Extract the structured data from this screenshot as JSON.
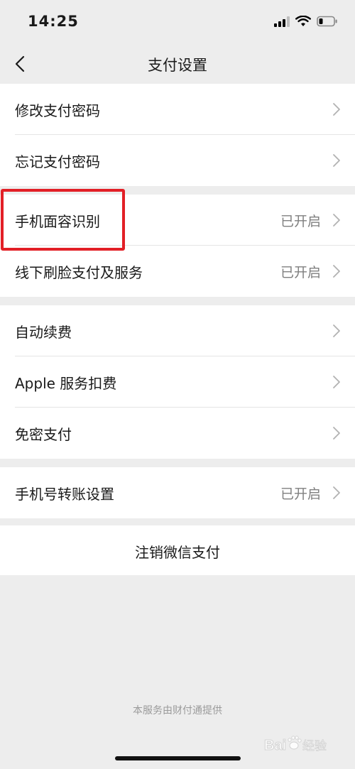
{
  "status_bar": {
    "time": "14:25",
    "icons": [
      "signal-icon",
      "wifi-icon",
      "battery-icon"
    ]
  },
  "nav": {
    "title": "支付设置",
    "back_icon": "chevron-left-icon"
  },
  "groups": [
    {
      "items": [
        {
          "label": "修改支付密码",
          "value": ""
        },
        {
          "label": "忘记支付密码",
          "value": ""
        }
      ]
    },
    {
      "items": [
        {
          "label": "手机面容识别",
          "value": "已开启"
        },
        {
          "label": "线下刷脸支付及服务",
          "value": "已开启"
        }
      ]
    },
    {
      "items": [
        {
          "label": "自动续费",
          "value": ""
        },
        {
          "label": "Apple 服务扣费",
          "value": ""
        },
        {
          "label": "免密支付",
          "value": ""
        }
      ]
    },
    {
      "items": [
        {
          "label": "手机号转账设置",
          "value": "已开启"
        }
      ]
    }
  ],
  "cancel": {
    "label": "注销微信支付"
  },
  "footer": {
    "note": "本服务由财付通提供"
  },
  "watermark": {
    "text": "Baidu经验"
  },
  "colors": {
    "background": "#ededed",
    "card": "#ffffff",
    "highlight": "#e21f26",
    "secondary_text": "#7f7f7f"
  }
}
